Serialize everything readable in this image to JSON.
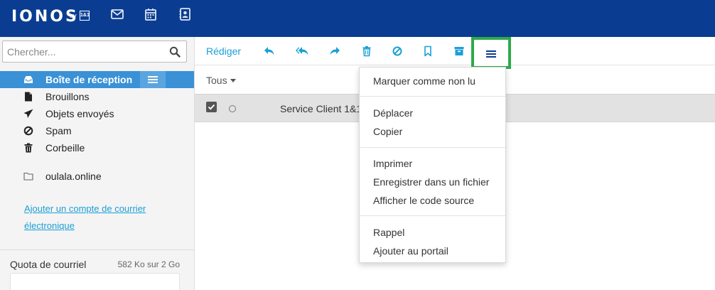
{
  "header": {
    "logo": "IONOS",
    "logo_by": "by",
    "logo_badge": "1&1",
    "icons": [
      "mail-icon",
      "calendar-icon",
      "contacts-icon"
    ]
  },
  "sidebar": {
    "search_placeholder": "Chercher...",
    "folders": [
      {
        "label": "Boîte de réception",
        "icon": "inbox-icon",
        "active": true
      },
      {
        "label": "Brouillons",
        "icon": "file-icon"
      },
      {
        "label": "Objets envoyés",
        "icon": "send-icon"
      },
      {
        "label": "Spam",
        "icon": "ban-icon"
      },
      {
        "label": "Corbeille",
        "icon": "trash-icon"
      },
      {
        "label": "oulala.online",
        "icon": "folder-icon"
      }
    ],
    "add_account": "Ajouter un compte de courrier électronique",
    "quota_label": "Quota de courriel",
    "quota_value": "582 Ko sur 2 Go"
  },
  "toolbar": {
    "compose": "Rédiger",
    "buttons": [
      "reply-icon",
      "reply-all-icon",
      "forward-icon",
      "delete-icon",
      "spam-icon",
      "flag-icon",
      "archive-icon",
      "more-menu-icon"
    ],
    "accent": "#1a9fd6",
    "highlight": "#2eaa4a"
  },
  "list": {
    "filter": "Tous",
    "rows": [
      {
        "sender": "Service Client 1&1",
        "selected": true
      }
    ]
  },
  "dropdown": {
    "items": [
      "Marquer comme non lu",
      "Déplacer",
      "Copier",
      "Imprimer",
      "Enregistrer dans un fichier",
      "Afficher le code source",
      "Rappel",
      "Ajouter au portail"
    ]
  }
}
